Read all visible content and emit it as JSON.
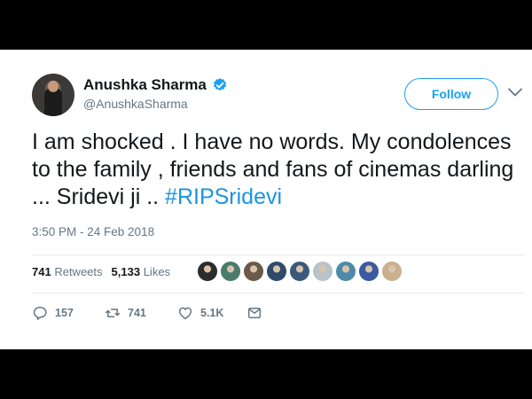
{
  "tweet": {
    "name": "Anushka Sharma",
    "handle": "@AnushkaSharma",
    "follow_label": "Follow",
    "text_main": "I am shocked . I have no words. My condolences to the family , friends and fans of cinemas darling ... Sridevi ji .. ",
    "hashtag": "#RIPSridevi",
    "timestamp": "3:50 PM - 24 Feb 2018",
    "retweets_count": "741",
    "retweets_label": "Retweets",
    "likes_count": "5,133",
    "likes_label": "Likes",
    "reply_count": "157",
    "retweet_action_count": "741",
    "like_action_count": "5.1K"
  },
  "icons": {
    "verified": "verified-badge-icon",
    "caret": "chevron-down-icon",
    "reply": "reply-icon",
    "retweet": "retweet-icon",
    "like": "heart-icon",
    "message": "direct-message-icon"
  },
  "colors": {
    "accent": "#1da1f2",
    "hashtag": "#1b95e0",
    "text": "#14171a",
    "muted": "#657786"
  },
  "liker_colors": [
    "#2c2c2c",
    "#4a7a6a",
    "#6b5a4a",
    "#2f4a6a",
    "#3a5a7a",
    "#b9c2c9",
    "#4f8aa8",
    "#3b5aa0",
    "#c8b090"
  ]
}
